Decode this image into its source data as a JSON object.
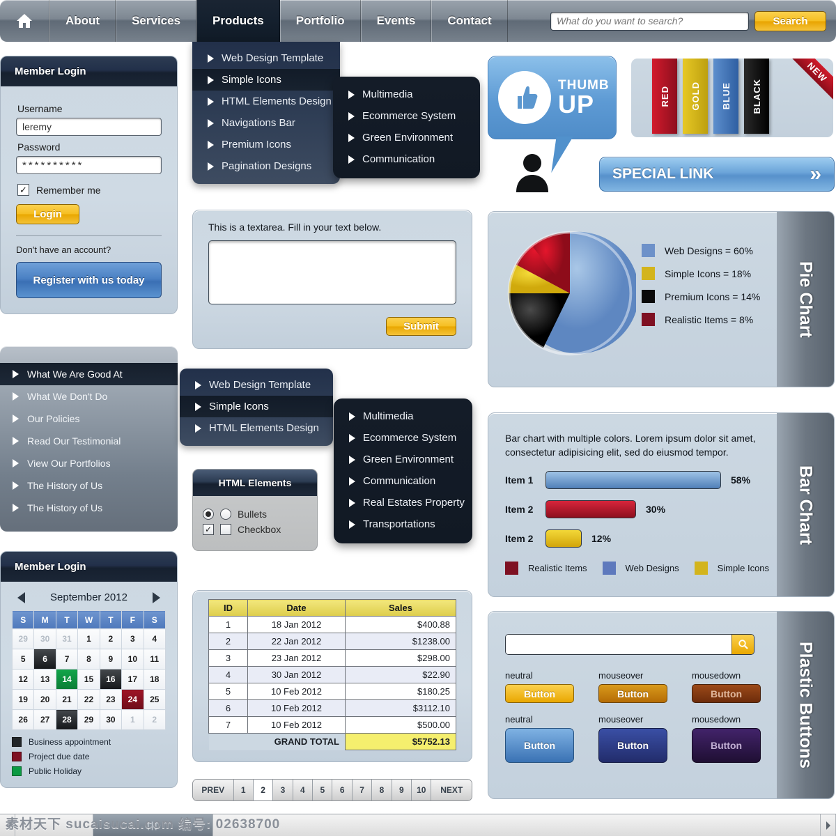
{
  "topnav": {
    "home_icon": "home-icon",
    "tabs": [
      {
        "label": "About",
        "active": false
      },
      {
        "label": "Services",
        "active": false
      },
      {
        "label": "Products",
        "active": true
      },
      {
        "label": "Portfolio",
        "active": false
      },
      {
        "label": "Events",
        "active": false
      },
      {
        "label": "Contact",
        "active": false
      }
    ],
    "search_placeholder": "What do you want to search?",
    "search_value": "",
    "search_button": "Search"
  },
  "products_menu": {
    "items": [
      {
        "label": "Web Design Template",
        "selected": false
      },
      {
        "label": "Simple Icons",
        "selected": true
      },
      {
        "label": "HTML Elements Design",
        "selected": false
      },
      {
        "label": "Navigations Bar",
        "selected": false
      },
      {
        "label": "Premium Icons",
        "selected": false
      },
      {
        "label": "Pagination Designs",
        "selected": false
      }
    ],
    "submenu": [
      "Multimedia",
      "Ecommerce System",
      "Green Environment",
      "Communication"
    ]
  },
  "member_login": {
    "title": "Member Login",
    "username_label": "Username",
    "username_value": "leremy",
    "password_label": "Password",
    "password_value": "**********",
    "remember_label": "Remember me",
    "remember_checked": true,
    "check_glyph": "✓",
    "login_button": "Login",
    "no_account_text": "Don't have an account?",
    "register_button": "Register with us today"
  },
  "side_menu": {
    "items": [
      {
        "label": "What We Are Good At",
        "selected": true
      },
      {
        "label": "What We Don't Do",
        "selected": false
      },
      {
        "label": "Our Policies",
        "selected": false
      },
      {
        "label": "Read Our Testimonial",
        "selected": false
      },
      {
        "label": "View Our Portfolios",
        "selected": false
      },
      {
        "label": "The History of Us",
        "selected": false
      },
      {
        "label": "The History of Us",
        "selected": false
      }
    ]
  },
  "side_dropdown": {
    "items": [
      {
        "label": "Web Design Template",
        "selected": false
      },
      {
        "label": "Simple Icons",
        "selected": true
      },
      {
        "label": "HTML Elements Design",
        "selected": false
      }
    ],
    "submenu": [
      "Multimedia",
      "Ecommerce System",
      "Green Environment",
      "Communication",
      "Real Estates Property",
      "Transportations"
    ]
  },
  "textarea_panel": {
    "label": "This is a textarea. Fill in your text below.",
    "value": "",
    "submit_button": "Submit"
  },
  "html_elements": {
    "title": "HTML Elements",
    "radio_label": "Bullets",
    "radio_checked": true,
    "checkbox_label": "Checkbox",
    "checkbox_checked": true,
    "check_glyph": "✓"
  },
  "calendar": {
    "title": "Member Login",
    "month_label": "September 2012",
    "prev_icon": "chevron-left-icon",
    "next_icon": "chevron-right-icon",
    "weekdays": [
      "S",
      "M",
      "T",
      "W",
      "T",
      "F",
      "S"
    ],
    "weeks": [
      [
        {
          "d": "29",
          "t": "mute"
        },
        {
          "d": "30",
          "t": "mute"
        },
        {
          "d": "31",
          "t": "mute"
        },
        {
          "d": "1",
          "t": ""
        },
        {
          "d": "2",
          "t": ""
        },
        {
          "d": "3",
          "t": ""
        },
        {
          "d": "4",
          "t": ""
        }
      ],
      [
        {
          "d": "5",
          "t": ""
        },
        {
          "d": "6",
          "t": "black"
        },
        {
          "d": "7",
          "t": ""
        },
        {
          "d": "8",
          "t": ""
        },
        {
          "d": "9",
          "t": ""
        },
        {
          "d": "10",
          "t": ""
        },
        {
          "d": "11",
          "t": ""
        }
      ],
      [
        {
          "d": "12",
          "t": ""
        },
        {
          "d": "13",
          "t": ""
        },
        {
          "d": "14",
          "t": "green"
        },
        {
          "d": "15",
          "t": ""
        },
        {
          "d": "16",
          "t": "black"
        },
        {
          "d": "17",
          "t": ""
        },
        {
          "d": "18",
          "t": ""
        }
      ],
      [
        {
          "d": "19",
          "t": ""
        },
        {
          "d": "20",
          "t": ""
        },
        {
          "d": "21",
          "t": ""
        },
        {
          "d": "22",
          "t": ""
        },
        {
          "d": "23",
          "t": ""
        },
        {
          "d": "24",
          "t": "red"
        },
        {
          "d": "25",
          "t": ""
        }
      ],
      [
        {
          "d": "26",
          "t": ""
        },
        {
          "d": "27",
          "t": ""
        },
        {
          "d": "28",
          "t": "black"
        },
        {
          "d": "29",
          "t": ""
        },
        {
          "d": "30",
          "t": ""
        },
        {
          "d": "1",
          "t": "mute"
        },
        {
          "d": "2",
          "t": "mute"
        }
      ]
    ],
    "legend": [
      {
        "label": "Business appointment",
        "color": "#222629"
      },
      {
        "label": "Project due date",
        "color": "#7e1022"
      },
      {
        "label": "Public Holiday",
        "color": "#0b9a42"
      }
    ]
  },
  "table": {
    "headers": [
      "ID",
      "Date",
      "Sales"
    ],
    "rows": [
      [
        "1",
        "18 Jan 2012",
        "$400.88"
      ],
      [
        "2",
        "22 Jan 2012",
        "$1238.00"
      ],
      [
        "3",
        "23 Jan 2012",
        "$298.00"
      ],
      [
        "4",
        "30 Jan 2012",
        "$22.90"
      ],
      [
        "5",
        "10 Feb 2012",
        "$180.25"
      ],
      [
        "6",
        "10 Feb 2012",
        "$3112.10"
      ],
      [
        "7",
        "10 Feb 2012",
        "$500.00"
      ]
    ],
    "total_label": "GRAND TOTAL",
    "total_value": "$5752.13"
  },
  "pagination": {
    "prev": "PREV",
    "next": "NEXT",
    "pages": [
      "1",
      "2",
      "3",
      "4",
      "5",
      "6",
      "7",
      "8",
      "9",
      "10"
    ],
    "active": "2"
  },
  "thumb_up": {
    "line1": "THUMB",
    "line2": "UP",
    "icon": "thumbs-up-icon",
    "avatar_icon": "person-icon"
  },
  "color_chips": {
    "items": [
      {
        "label": "RED",
        "color": "#b3132a"
      },
      {
        "label": "GOLD",
        "color": "#d3b41c"
      },
      {
        "label": "BLUE",
        "color": "#3e72b8"
      },
      {
        "label": "BLACK",
        "color": "#101010"
      }
    ],
    "badge": "NEW"
  },
  "special_link": {
    "label": "SPECIAL LINK",
    "chevron_icon": "double-chevron-right-icon"
  },
  "pie_panel": {
    "side_label": "Pie Chart"
  },
  "bar_panel": {
    "side_label": "Bar Chart"
  },
  "buttons_panel": {
    "side_label": "Plastic Buttons",
    "search_value": "",
    "search_icon": "search-icon",
    "rows": [
      {
        "states": [
          "neutral",
          "mouseover",
          "mousedown"
        ],
        "buttons": [
          {
            "label": "Button",
            "c1": "#fbd14e",
            "c2": "#e9a701",
            "border": "#8a6406",
            "text": "#ffffff"
          },
          {
            "label": "Button",
            "c1": "#d99a1c",
            "c2": "#b56c05",
            "border": "#6e4404",
            "text": "#ffffff"
          },
          {
            "label": "Button",
            "c1": "#9c4a19",
            "c2": "#6d2c0b",
            "border": "#46200a",
            "text": "#e0b69c"
          }
        ]
      },
      {
        "states": [
          "neutral",
          "mouseover",
          "mousedown"
        ],
        "buttons": [
          {
            "label": "Button",
            "c1": "#6fa8dd",
            "c2": "#3a72b4",
            "border": "#27527f",
            "text": "#ffffff"
          },
          {
            "label": "Button",
            "c1": "#32479a",
            "c2": "#242f72",
            "border": "#151c45",
            "text": "#ffffff"
          },
          {
            "label": "Button",
            "c1": "#3b1f5e",
            "c2": "#22113a",
            "border": "#140a22",
            "text": "#c0aed2"
          }
        ]
      }
    ]
  },
  "chart_data": [
    {
      "type": "pie",
      "title": "Pie Chart",
      "labels": [
        "Web Designs",
        "Simple Icons",
        "Premium Icons",
        "Realistic Items"
      ],
      "values": [
        60,
        18,
        14,
        8
      ],
      "colors": [
        "#6d91c9",
        "#d3b41c",
        "#0a0a0a",
        "#7e1022"
      ],
      "legend_entries": [
        "Web Designs = 60%",
        "Simple Icons = 18%",
        "Premium Icons = 14%",
        "Realistic Items = 8%"
      ],
      "legend_position": "right",
      "unit": "%"
    },
    {
      "type": "bar",
      "title": "Bar Chart",
      "subtitle": "Bar chart with multiple colors. Lorem ipsum dolor sit amet, consectetur adipisicing elit, sed do eiusmod tempor.",
      "orientation": "horizontal",
      "categories": [
        "Item 1",
        "Item 2",
        "Item 2"
      ],
      "values": [
        58,
        30,
        12
      ],
      "value_labels": [
        "58%",
        "30%",
        "12%"
      ],
      "colors": [
        "#5e8fc8",
        "#b3132a",
        "#e2c016"
      ],
      "xlabel": "",
      "ylabel": "",
      "xlim": [
        0,
        100
      ],
      "grid": false,
      "legend_position": "bottom",
      "legend": [
        {
          "label": "Realistic Items",
          "color": "#7e1022"
        },
        {
          "label": "Web Designs",
          "color": "#5e79bd"
        },
        {
          "label": "Simple Icons",
          "color": "#d3b41c"
        }
      ]
    }
  ],
  "watermark": {
    "text": "素材天下 sucaisucai.com  编号: 02638700"
  }
}
